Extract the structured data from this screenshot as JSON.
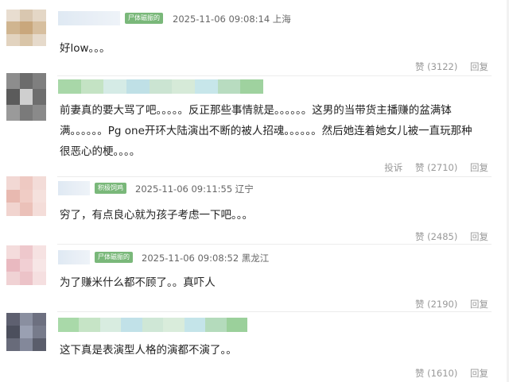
{
  "comments": [
    {
      "badge": "尸体磁振的",
      "time": "2025-11-06 09:08:14",
      "location": "上海",
      "text": "好low。。。",
      "report": "",
      "like_label": "赞",
      "likes": "(3122)",
      "reply_label": "回复"
    },
    {
      "badge": "",
      "time": "",
      "location": "",
      "text": "前妻真的要大骂了吧。。。。。反正那些事情就是。。。。。。这男的当带货主播赚的盆满钵满。。。。。。Pg one开环大陆演出不断的被人招魂。。。。。。然后她连着她女儿被一直玩那种很恶心的梗。。。。",
      "report": "投诉",
      "like_label": "赞",
      "likes": "(2710)",
      "reply_label": "回复"
    },
    {
      "badge": "积极饲鸡",
      "time": "2025-11-06 09:11:55",
      "location": "辽宁",
      "text": "穷了，有点良心就为孩子考虑一下吧。。。",
      "report": "",
      "like_label": "赞",
      "likes": "(2485)",
      "reply_label": "回复"
    },
    {
      "badge": "尸体磁振的",
      "time": "2025-11-06 09:08:52",
      "location": "黑龙江",
      "text": "为了赚米什么都不顾了。。真吓人",
      "report": "",
      "like_label": "赞",
      "likes": "(2190)",
      "reply_label": "回复"
    },
    {
      "badge": "",
      "time": "",
      "location": "",
      "text": "这下真是表演型人格的演都不演了。。",
      "report": "",
      "like_label": "赞",
      "likes": "(1610)",
      "reply_label": "回复"
    }
  ]
}
